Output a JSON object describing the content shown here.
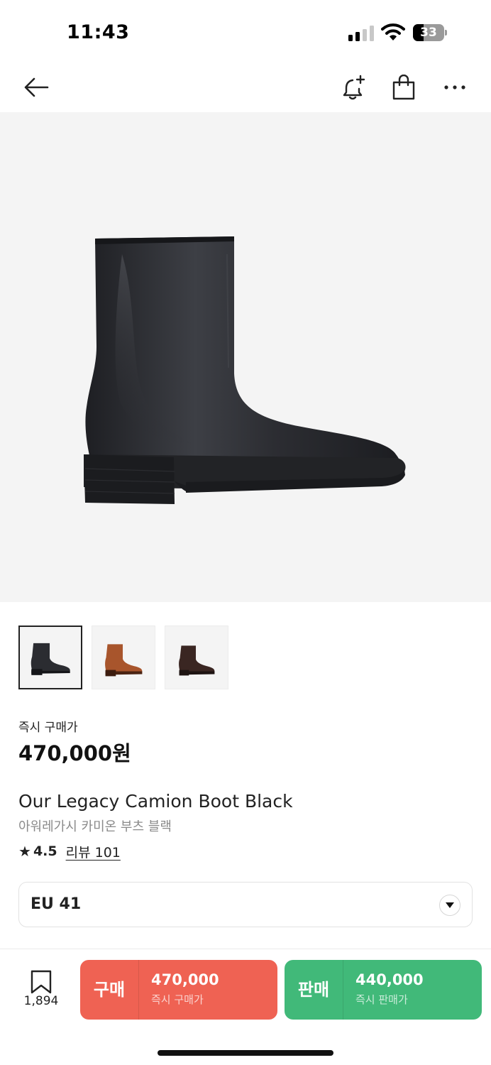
{
  "status_bar": {
    "time": "11:43",
    "battery_level": "33",
    "battery_fraction": 0.33,
    "signal_bars_filled": 2,
    "signal_bars_total": 4
  },
  "nav": {
    "back_icon": "arrow-left-icon",
    "icons": [
      "bell-plus-icon",
      "shopping-bag-icon",
      "more-horizontal-icon"
    ]
  },
  "product": {
    "hero_icon": "black-leather-boot-image",
    "thumbnails": [
      {
        "color": "#2b2c31",
        "icon": "boot-black-thumbnail",
        "selected": true
      },
      {
        "color": "#a8552c",
        "icon": "boot-brown-thumbnail",
        "selected": false
      },
      {
        "color": "#3a2622",
        "icon": "boot-dark-brown-thumbnail",
        "selected": false
      }
    ],
    "price_label": "즉시 구매가",
    "price": "470,000원",
    "name": "Our Legacy Camion Boot Black",
    "name_ko": "아워레가시 카미온 부츠 블랙",
    "rating_star": "★",
    "rating": "4.5",
    "reviews_label": "리뷰 101"
  },
  "size_select": {
    "value": "EU 41",
    "icon": "chevron-down-icon"
  },
  "bottom_bar": {
    "bookmark_icon": "bookmark-icon",
    "bookmark_count": "1,894",
    "buy": {
      "label": "구매",
      "price": "470,000",
      "sub": "즉시 구매가",
      "color": "#ef6253"
    },
    "sell": {
      "label": "판매",
      "price": "440,000",
      "sub": "즉시 판매가",
      "color": "#41b979"
    }
  }
}
